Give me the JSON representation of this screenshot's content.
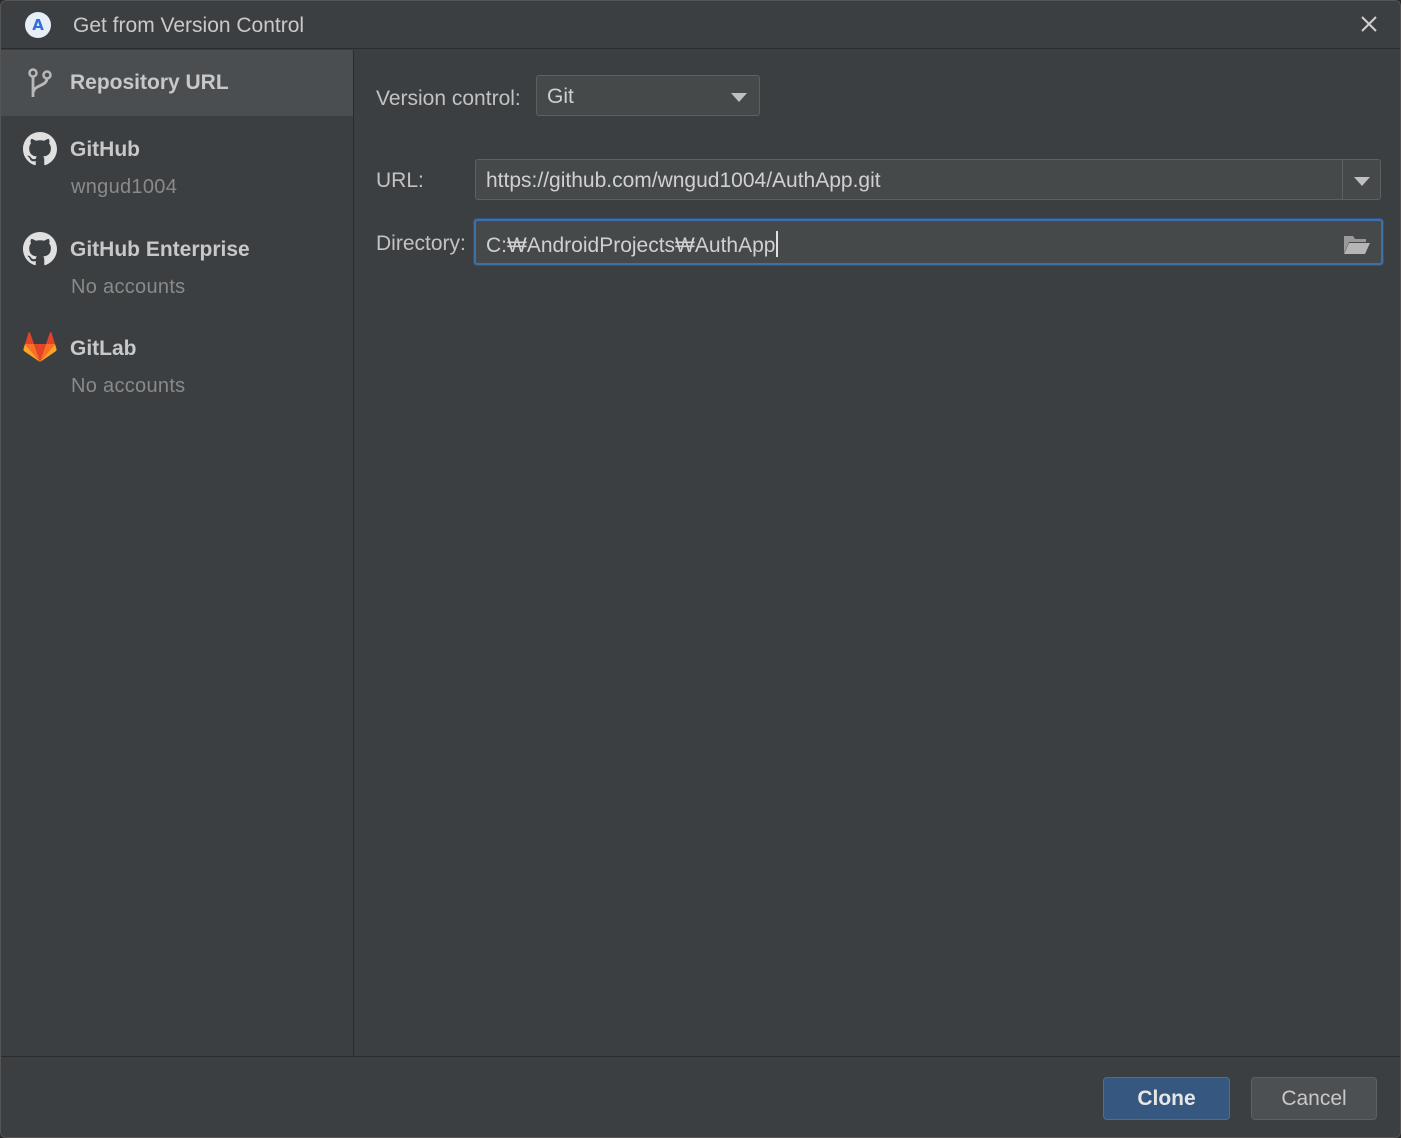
{
  "window": {
    "title": "Get from Version Control",
    "app_icon_glyph": "A",
    "close_glyph": "close-icon"
  },
  "sidebar": {
    "items": [
      {
        "label": "Repository URL",
        "sub": "",
        "icon": "vcs-branch-icon",
        "selected": true
      },
      {
        "label": "GitHub",
        "sub": "wngud1004",
        "icon": "github-icon",
        "selected": false
      },
      {
        "label": "GitHub Enterprise",
        "sub": "No accounts",
        "icon": "github-icon",
        "selected": false
      },
      {
        "label": "GitLab",
        "sub": "No accounts",
        "icon": "gitlab-icon",
        "selected": false
      }
    ]
  },
  "form": {
    "version_control_label": "Version control:",
    "version_control_value": "Git",
    "url_label": "URL:",
    "url_value": "https://github.com/wngud1004/AuthApp.git",
    "directory_label": "Directory:",
    "directory_value": "C:₩AndroidProjects₩AuthApp"
  },
  "footer": {
    "clone_label": "Clone",
    "cancel_label": "Cancel"
  },
  "colors": {
    "background": "#3c3f41",
    "selected_item": "#4b4e50",
    "focus_border": "#3d6fa8",
    "primary_button": "#365880",
    "gitlab_orange": "#e24329"
  }
}
